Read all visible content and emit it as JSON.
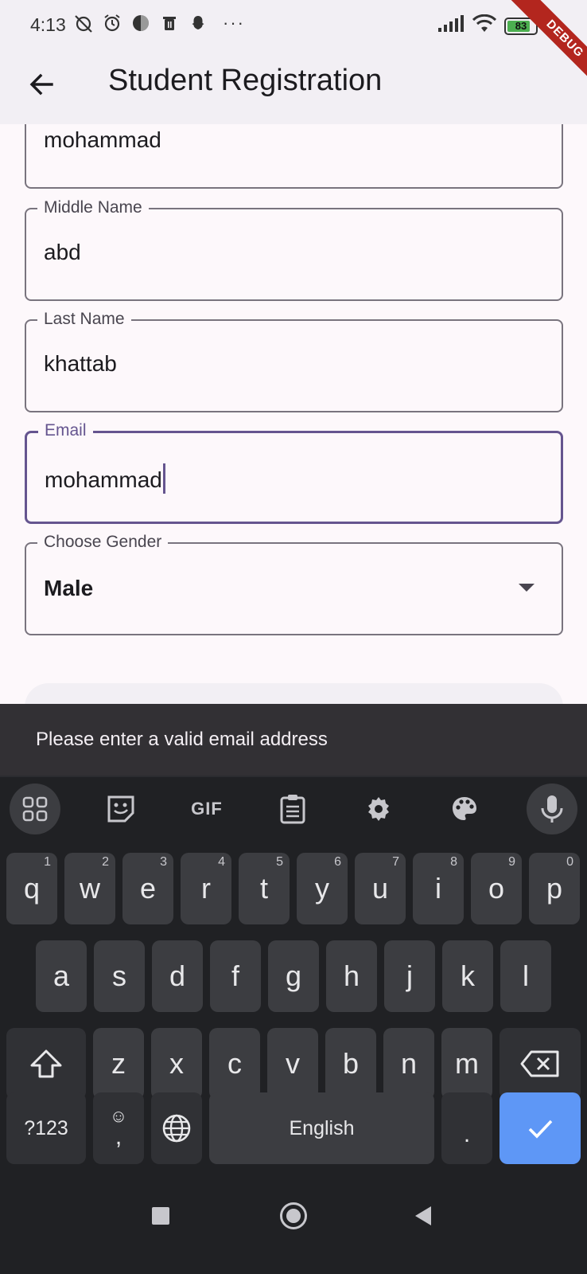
{
  "status_bar": {
    "time": "4:13",
    "battery": "83",
    "battery_level": 0.83,
    "more": "···",
    "debug_banner": "DEBUG"
  },
  "app_bar": {
    "title": "Student Registration",
    "back_icon": "arrow-back-icon"
  },
  "form": {
    "first_name": {
      "value": "mohammad"
    },
    "middle_name": {
      "label": "Middle Name",
      "value": "abd"
    },
    "last_name": {
      "label": "Last Name",
      "value": "khattab"
    },
    "email": {
      "label": "Email",
      "value": "mohammad"
    },
    "gender": {
      "label": "Choose Gender",
      "value": "Male"
    }
  },
  "snackbar": {
    "message": "Please enter a valid email address"
  },
  "keyboard": {
    "toolbar": {
      "gif": "GIF",
      "icons": [
        "apps-grid-icon",
        "sticker-icon",
        "gif-icon",
        "clipboard-icon",
        "settings-icon",
        "palette-icon",
        "mic-icon"
      ]
    },
    "row1": [
      {
        "k": "q",
        "h": "1"
      },
      {
        "k": "w",
        "h": "2"
      },
      {
        "k": "e",
        "h": "3"
      },
      {
        "k": "r",
        "h": "4"
      },
      {
        "k": "t",
        "h": "5"
      },
      {
        "k": "y",
        "h": "6"
      },
      {
        "k": "u",
        "h": "7"
      },
      {
        "k": "i",
        "h": "8"
      },
      {
        "k": "o",
        "h": "9"
      },
      {
        "k": "p",
        "h": "0"
      }
    ],
    "row2": [
      "a",
      "s",
      "d",
      "f",
      "g",
      "h",
      "j",
      "k",
      "l"
    ],
    "row3": [
      "z",
      "x",
      "c",
      "v",
      "b",
      "n",
      "m"
    ],
    "symbols": "?123",
    "emoji_comma": ",",
    "space": "English",
    "period": "."
  },
  "colors": {
    "accent": "#65558f",
    "keyboard_bg": "#202124",
    "key_bg": "#3c3d41",
    "action_key": "#5e97f6"
  }
}
